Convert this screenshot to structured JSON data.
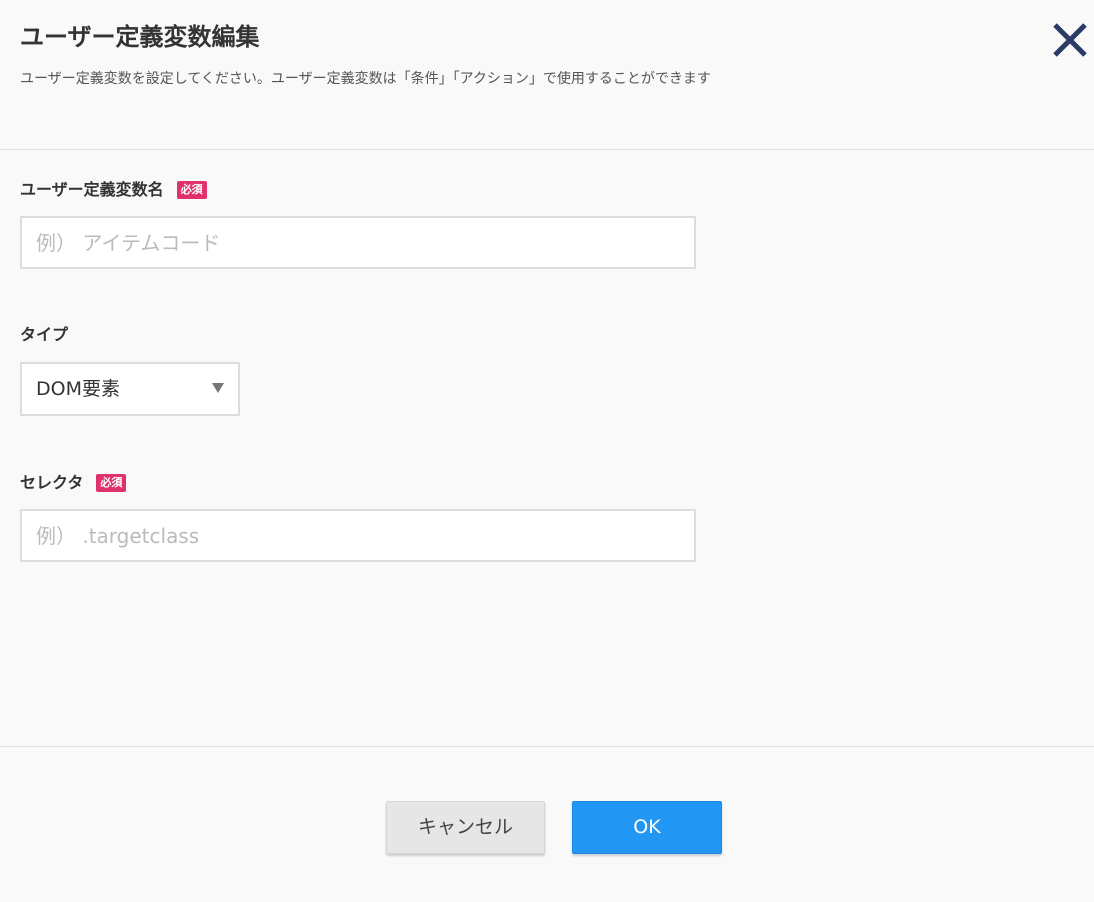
{
  "dialog": {
    "title": "ユーザー定義変数編集",
    "description": "ユーザー定義変数を設定してください。ユーザー定義変数は「条件」「アクション」で使用することができます",
    "close_icon": "close-icon"
  },
  "fields": {
    "name": {
      "label": "ユーザー定義変数名",
      "required_badge": "必須",
      "value": "",
      "placeholder": "例） アイテムコード"
    },
    "type": {
      "label": "タイプ",
      "selected": "DOM要素",
      "arrow_icon": "triangle-down-icon"
    },
    "selector": {
      "label": "セレクタ",
      "required_badge": "必須",
      "value": "",
      "placeholder": "例） .targetclass"
    }
  },
  "buttons": {
    "cancel_label": "キャンセル",
    "ok_label": "OK"
  },
  "colors": {
    "background": "#f9f9f9",
    "close_icon": "#2b3a67",
    "required_badge": "#e0306e",
    "primary_button": "#2196f3",
    "secondary_button": "#e6e6e6",
    "input_border": "#dddddd"
  }
}
